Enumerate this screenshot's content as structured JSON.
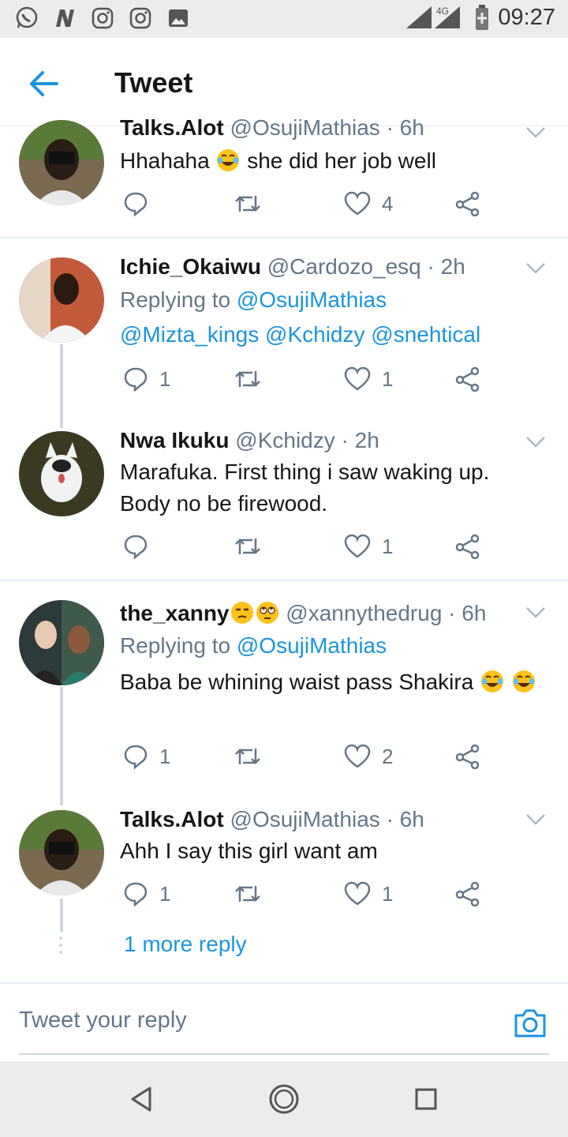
{
  "status_bar": {
    "time": "09:27",
    "network": "4G",
    "left_icons": [
      "whatsapp-icon",
      "n-icon",
      "instagram-icon",
      "instagram-icon",
      "image-icon"
    ]
  },
  "header": {
    "title": "Tweet"
  },
  "tweets": [
    {
      "name": "Talks.Alot",
      "handle": "@OsujiMathias",
      "time": "· 6h",
      "text": "Hhahaha",
      "text_after": "she did her job well",
      "replies": "",
      "retweets": "",
      "likes": "4"
    },
    {
      "name": "Ichie_Okaiwu",
      "handle": "@Cardozo_esq",
      "time": "· 2h",
      "replying_label": "Replying to",
      "replying_to": "@OsujiMathias",
      "mentions": "@Mizta_kings @Kchidzy @snehtical",
      "replies": "1",
      "retweets": "",
      "likes": "1"
    },
    {
      "name": "Nwa Ikuku",
      "handle": "@Kchidzy",
      "time": "· 2h",
      "text_line1": "Marafuka. First thing i saw waking up.",
      "text_line2": "Body no be firewood.",
      "replies": "",
      "retweets": "",
      "likes": "1"
    },
    {
      "name": "the_xanny",
      "handle": "@xannythedrug",
      "time": "· 6h",
      "replying_label": "Replying to",
      "replying_to": "@OsujiMathias",
      "text": "Baba be whining waist pass Shakira",
      "replies": "1",
      "retweets": "",
      "likes": "2"
    },
    {
      "name": "Talks.Alot",
      "handle": "@OsujiMathias",
      "time": "· 6h",
      "text": "Ahh I say this girl want am",
      "replies": "1",
      "retweets": "",
      "likes": "1"
    }
  ],
  "more_reply": "1 more reply",
  "composer": {
    "placeholder": "Tweet your reply"
  },
  "colors": {
    "accent": "#1b95e0",
    "secondary_text": "#657786",
    "divider": "#e6ecf0",
    "thread_line": "#ccd6dd"
  }
}
